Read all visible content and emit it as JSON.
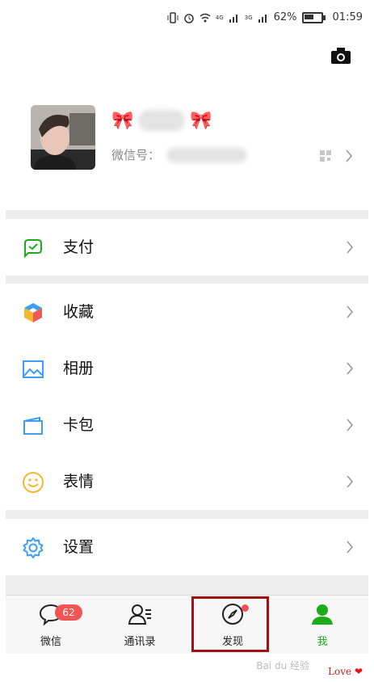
{
  "status_bar": {
    "network_4g": "4G",
    "network_3g": "3G",
    "battery": "62%",
    "time": "01:59"
  },
  "profile": {
    "wechat_id_label": "微信号："
  },
  "menu": {
    "pay": "支付",
    "favorites": "收藏",
    "album": "相册",
    "cards": "卡包",
    "stickers": "表情",
    "settings": "设置"
  },
  "tabbar": {
    "chats": "微信",
    "chats_badge": "62",
    "contacts": "通讯录",
    "discover": "发现",
    "me": "我"
  },
  "watermark": {
    "site": "Bai du 经验",
    "love": "Love"
  },
  "colors": {
    "accent_green": "#1aad19",
    "badge_red": "#f15454",
    "highlight_border": "#a01010"
  }
}
